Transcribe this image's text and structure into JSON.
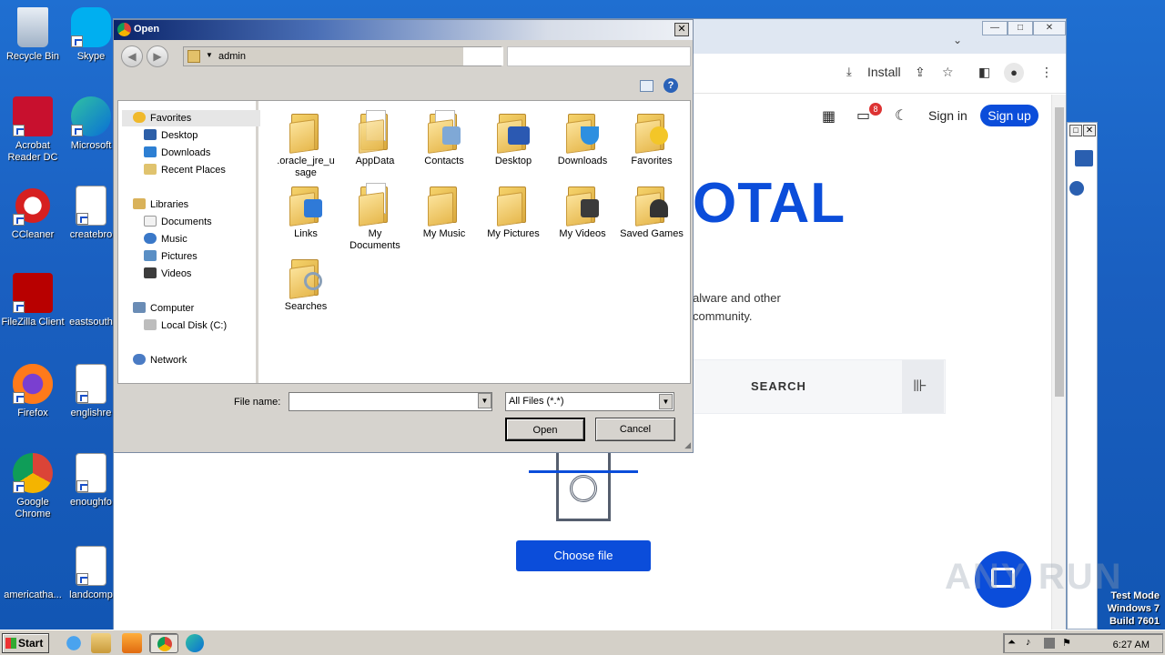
{
  "desktop": {
    "icons": [
      {
        "label": "Recycle Bin"
      },
      {
        "label": "Skype"
      },
      {
        "label": "Acrobat Reader DC"
      },
      {
        "label": "Microsoft"
      },
      {
        "label": "CCleaner"
      },
      {
        "label": "createbro"
      },
      {
        "label": "FileZilla Client"
      },
      {
        "label": "eastsouth"
      },
      {
        "label": "Firefox"
      },
      {
        "label": "englishre"
      },
      {
        "label": "Google Chrome"
      },
      {
        "label": "enoughfo"
      },
      {
        "label": "americatha..."
      },
      {
        "label": "landcomp"
      }
    ]
  },
  "browser": {
    "toolbar": {
      "install_label": "Install"
    },
    "header": {
      "signin": "Sign in",
      "signup": "Sign up",
      "notif_count": "8"
    },
    "logo_text": "OTAL",
    "desc_line1": "alware and other",
    "desc_line2": "community.",
    "search_label": "SEARCH",
    "choose_file": "Choose file"
  },
  "dialog": {
    "title": "Open",
    "address": "admin",
    "nav": {
      "favorites": "Favorites",
      "desktop": "Desktop",
      "downloads": "Downloads",
      "recent": "Recent Places",
      "libraries": "Libraries",
      "documents": "Documents",
      "music": "Music",
      "pictures": "Pictures",
      "videos": "Videos",
      "computer": "Computer",
      "local_disk": "Local Disk (C:)",
      "network": "Network"
    },
    "folders": [
      {
        "name": ".oracle_jre_u sage"
      },
      {
        "name": "AppData"
      },
      {
        "name": "Contacts"
      },
      {
        "name": "Desktop"
      },
      {
        "name": "Downloads"
      },
      {
        "name": "Favorites"
      },
      {
        "name": "Links"
      },
      {
        "name": "My Documents"
      },
      {
        "name": "My Music"
      },
      {
        "name": "My Pictures"
      },
      {
        "name": "My Videos"
      },
      {
        "name": "Saved Games"
      },
      {
        "name": "Searches"
      }
    ],
    "filename_label": "File name:",
    "filename_value": "",
    "filetype": "All Files (*.*)",
    "open_label": "Open",
    "cancel_label": "Cancel"
  },
  "taskbar": {
    "start": "Start",
    "clock": "6:27 AM"
  },
  "watermark": "ANY RUN",
  "test_mode": {
    "line1": "Test Mode",
    "line2": "Windows 7",
    "line3": "Build 7601"
  }
}
